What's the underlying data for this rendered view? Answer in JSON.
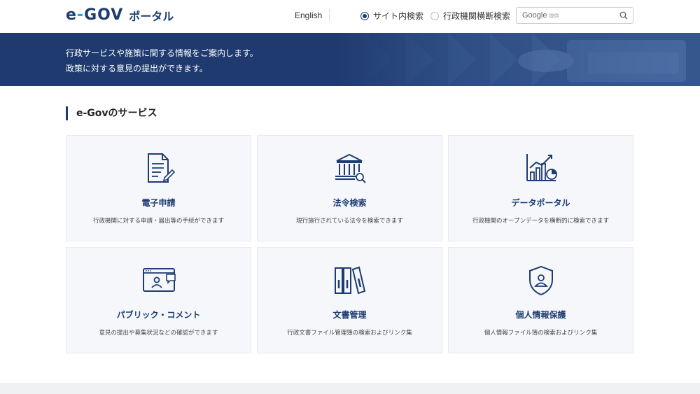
{
  "header": {
    "logo_main": "e-GOV",
    "logo_sub": "ポータル",
    "lang_link": "English",
    "search_scope": [
      {
        "label": "サイト内検索",
        "selected": true
      },
      {
        "label": "行政機関横断検索",
        "selected": false
      }
    ],
    "search": {
      "brand": "Google",
      "brand_sub": "提供",
      "placeholder": ""
    }
  },
  "banner": {
    "line1": "行政サービスや施策に関する情報をご案内します。",
    "line2": "政策に対する意見の提出ができます。"
  },
  "section": {
    "title": "e-Govのサービス",
    "cards": [
      {
        "title": "電子申請",
        "desc": "行政機関に対する申請・届出等の手続ができます",
        "icon": "document-pen-icon"
      },
      {
        "title": "法令検索",
        "desc": "現行施行されている法令を検索できます",
        "icon": "building-search-icon"
      },
      {
        "title": "データポータル",
        "desc": "行政機関のオープンデータを横断的に検索できます",
        "icon": "chart-icon"
      },
      {
        "title": "パブリック・コメント",
        "desc": "意見の提出や募集状況などの確認ができます",
        "icon": "browser-comment-icon"
      },
      {
        "title": "文書管理",
        "desc": "行政文書ファイル管理簿の検索およびリンク集",
        "icon": "binders-icon"
      },
      {
        "title": "個人情報保護",
        "desc": "個人情報ファイル簿の検索およびリンク集",
        "icon": "shield-person-icon"
      }
    ]
  },
  "colors": {
    "brand": "#1e3c72",
    "banner": "#1f3a6e",
    "card_bg": "#f5f7fa"
  }
}
